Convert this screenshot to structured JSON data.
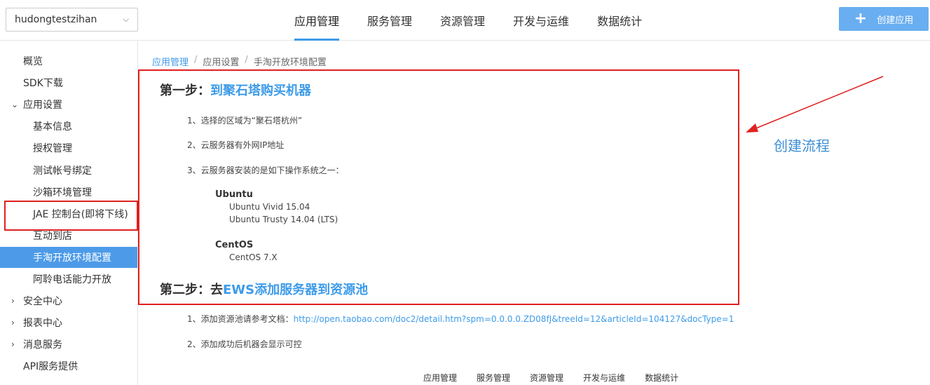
{
  "header": {
    "app_selector": "hudongtestzihan",
    "tabs": [
      "应用管理",
      "服务管理",
      "资源管理",
      "开发与运维",
      "数据统计"
    ],
    "active_tab": 0,
    "create_button": "创建应用"
  },
  "sidebar": {
    "items": [
      {
        "label": "概览",
        "level": 1,
        "arrow": ""
      },
      {
        "label": "SDK下载",
        "level": 1,
        "arrow": ""
      },
      {
        "label": "应用设置",
        "level": 1,
        "arrow": "expanded"
      },
      {
        "label": "基本信息",
        "level": 2,
        "arrow": ""
      },
      {
        "label": "授权管理",
        "level": 2,
        "arrow": ""
      },
      {
        "label": "测试帐号绑定",
        "level": 2,
        "arrow": ""
      },
      {
        "label": "沙箱环境管理",
        "level": 2,
        "arrow": ""
      },
      {
        "label": "JAE 控制台(即将下线)",
        "level": 2,
        "arrow": ""
      },
      {
        "label": "互动到店",
        "level": 2,
        "arrow": ""
      },
      {
        "label": "手淘开放环境配置",
        "level": 2,
        "arrow": "",
        "active": true
      },
      {
        "label": "阿聆电话能力开放",
        "level": 2,
        "arrow": ""
      },
      {
        "label": "安全中心",
        "level": 1,
        "arrow": "collapsed"
      },
      {
        "label": "报表中心",
        "level": 1,
        "arrow": "collapsed"
      },
      {
        "label": "消息服务",
        "level": 1,
        "arrow": "collapsed"
      },
      {
        "label": "API服务提供",
        "level": 1,
        "arrow": ""
      }
    ]
  },
  "breadcrumb": [
    "应用管理",
    "应用设置",
    "手淘开放环境配置"
  ],
  "step1": {
    "prefix": "第一步：",
    "highlight": "到聚石塔购买机器",
    "items": [
      "1、选择的区域为“聚石塔杭州”",
      "2、云服务器有外网IP地址",
      "3、云服务器安装的是如下操作系统之一："
    ],
    "os": [
      {
        "name": "Ubuntu",
        "versions": [
          "Ubuntu Vivid 15.04",
          "Ubuntu Trusty 14.04 (LTS)"
        ]
      },
      {
        "name": "CentOS",
        "versions": [
          "CentOS 7.X"
        ]
      }
    ]
  },
  "step2": {
    "prefix": "第二步：去",
    "highlight": "EWS添加服务器到资源池",
    "item1_prefix": "1、添加资源池请参考文档：",
    "item1_link": "http://open.taobao.com/doc2/detail.htm?spm=0.0.0.0.ZD08fJ&treeId=12&articleId=104127&docType=1",
    "item2": "2、添加成功后机器会显示可控"
  },
  "annotation": {
    "label": "创建流程",
    "color": "#e02020"
  },
  "footer_nav": [
    "应用管理",
    "服务管理",
    "资源管理",
    "开发与运维",
    "数据统计"
  ],
  "colors": {
    "accent": "#3d9be9",
    "annotation_red": "#e02020",
    "button": "#69aef0"
  }
}
